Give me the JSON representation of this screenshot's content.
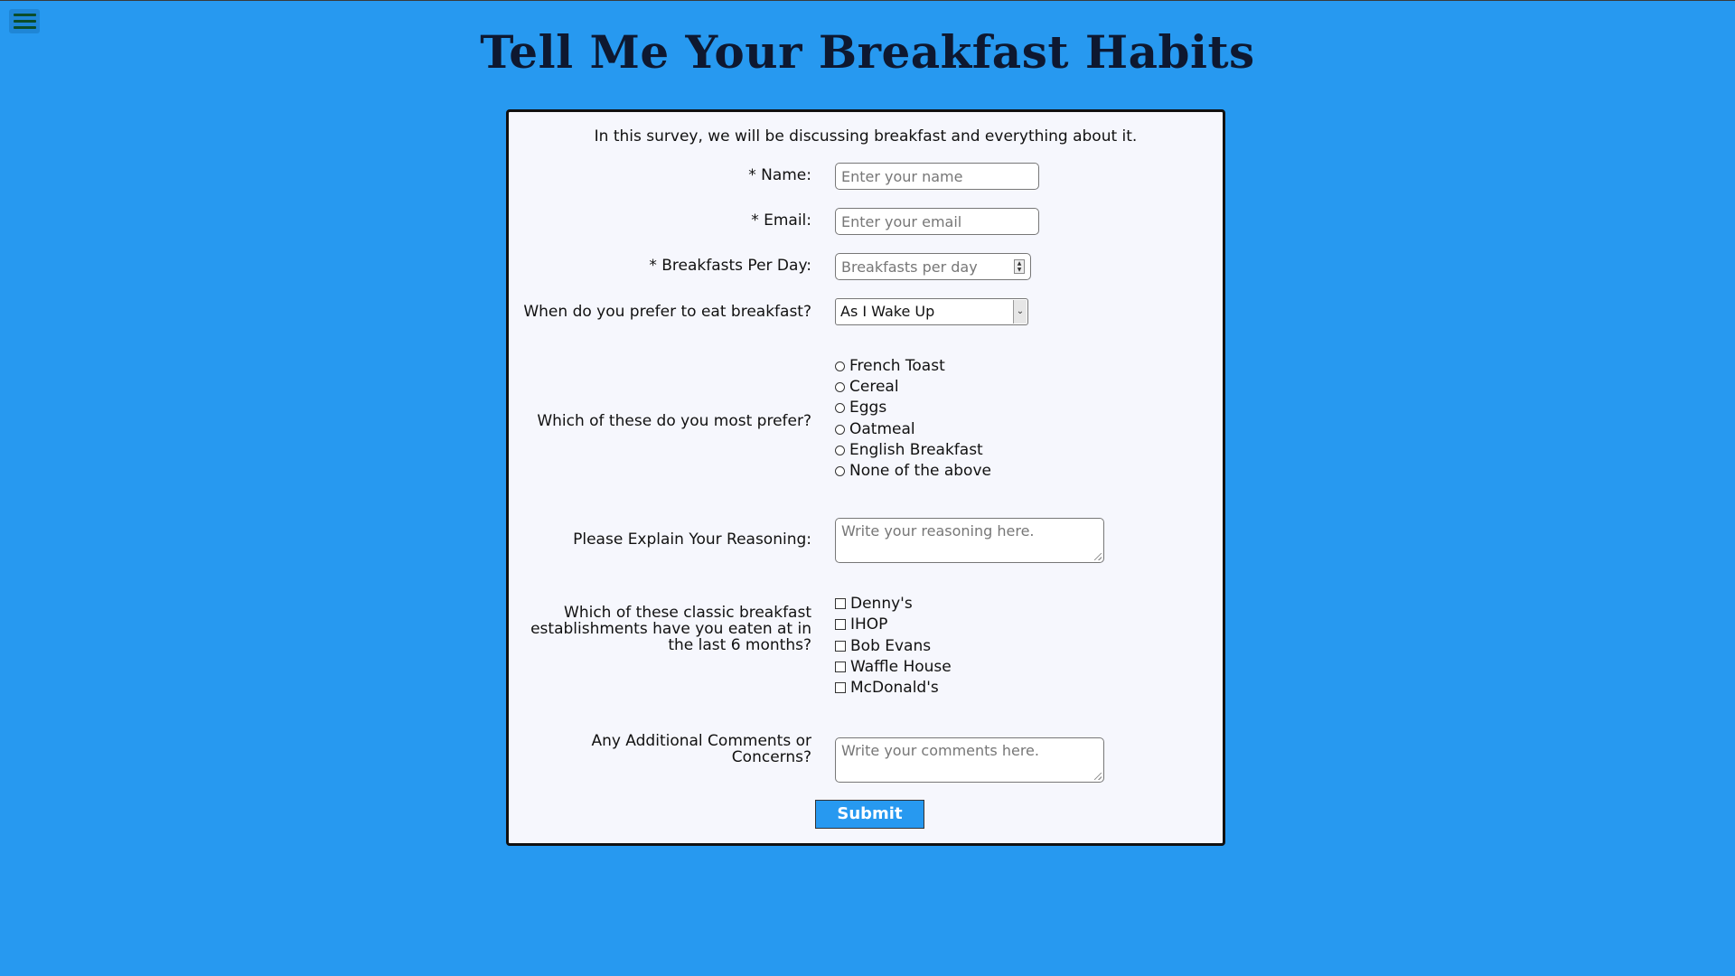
{
  "page": {
    "title": "Tell Me Your Breakfast Habits",
    "background_color": "#2799f0"
  },
  "menu": {
    "icon": "hamburger-menu-icon"
  },
  "form": {
    "intro": "In this survey, we will be discussing breakfast and everything about it.",
    "name": {
      "label": "* Name:",
      "placeholder": "Enter your name"
    },
    "email": {
      "label": "* Email:",
      "placeholder": "Enter your email"
    },
    "breakfasts": {
      "label": "* Breakfasts Per Day:",
      "placeholder": "Breakfasts per day"
    },
    "when": {
      "label": "When do you prefer to eat breakfast?",
      "selected": "As I Wake Up"
    },
    "prefer": {
      "label": "Which of these do you most prefer?",
      "options": [
        "French Toast",
        "Cereal",
        "Eggs",
        "Oatmeal",
        "English Breakfast",
        "None of the above"
      ]
    },
    "reasoning": {
      "label": "Please Explain Your Reasoning:",
      "placeholder": "Write your reasoning here."
    },
    "establishments": {
      "label_lines": [
        "Which of these classic breakfast",
        "establishments have you eaten at in",
        "the last 6 months?"
      ],
      "options": [
        "Denny's",
        "IHOP",
        "Bob Evans",
        "Waffle House",
        "McDonald's"
      ]
    },
    "comments": {
      "label_lines": [
        "Any Additional Comments or",
        "Concerns?"
      ],
      "placeholder": "Write your comments here."
    },
    "submit_label": "Submit",
    "accent_color": "#2799f0"
  }
}
